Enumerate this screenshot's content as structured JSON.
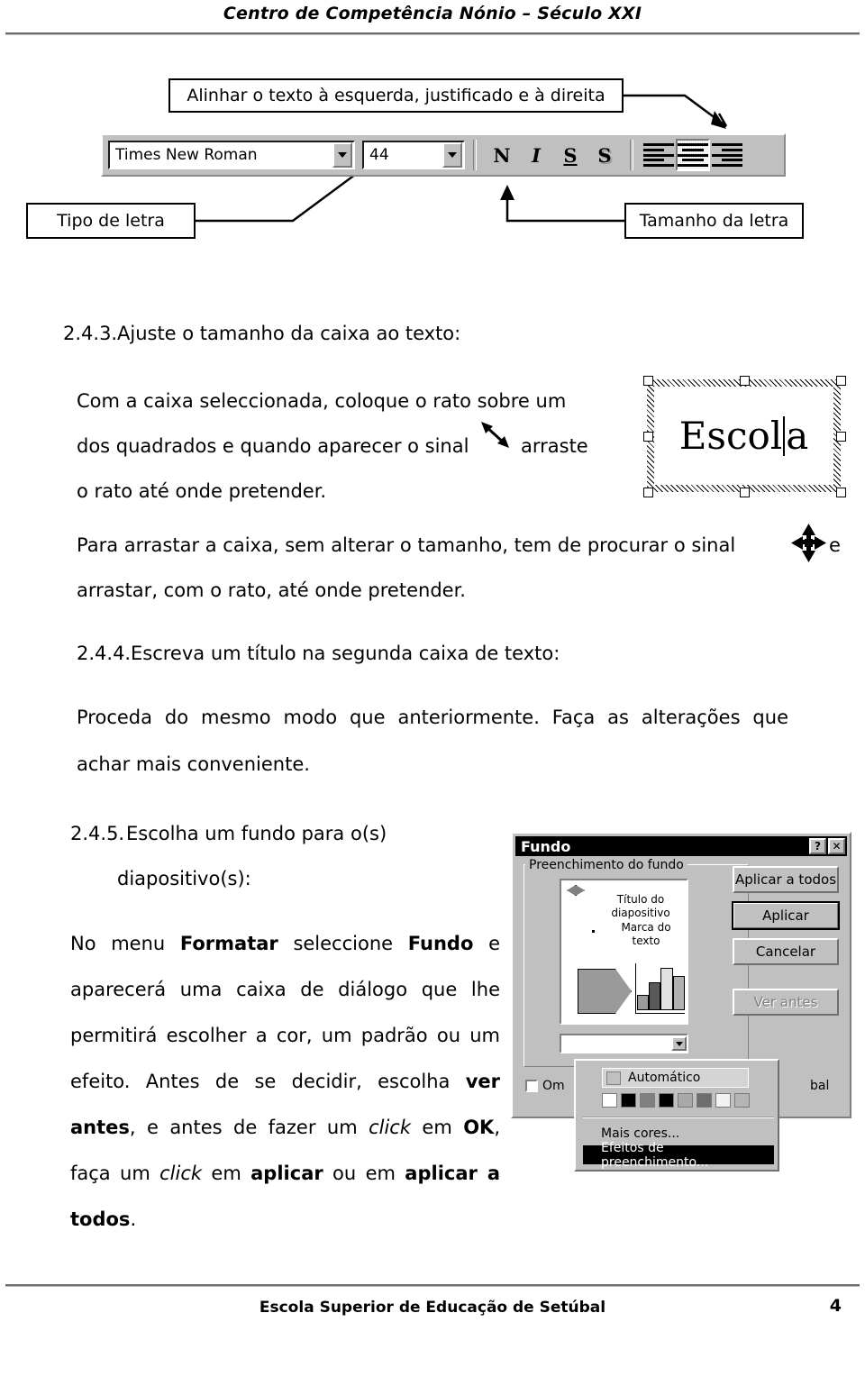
{
  "header": {
    "title": "Centro de Competência Nónio – Século XXI"
  },
  "callouts": {
    "align": "Alinhar o texto à esquerda, justificado e à direita",
    "font_type": "Tipo de letra",
    "font_size": "Tamanho da letra"
  },
  "toolbar": {
    "font_name": "Times New Roman",
    "font_size": "44",
    "bold_label": "N",
    "italic_label": "I",
    "underline_label": "S",
    "shadow_label": "S",
    "align_left_name": "align-left",
    "align_center_name": "align-center",
    "align_right_name": "align-right"
  },
  "sections": {
    "s243": {
      "number": "2.4.3.",
      "heading": "Ajuste o tamanho da caixa ao texto:",
      "para_1a": "Com a caixa seleccionada, coloque o rato sobre um",
      "para_1b": "dos quadrados e quando aparecer o sinal",
      "para_1c": "arraste",
      "para_1d": "o rato até onde pretender.",
      "para_2a": "Para arrastar a caixa, sem alterar o tamanho, tem de procurar o sinal",
      "para_2b": "e",
      "para_2c": "arrastar, com o rato, até onde pretender."
    },
    "s244": {
      "number": "2.4.4.",
      "heading": "Escreva um título na segunda caixa de texto:",
      "para": "Proceda do mesmo modo que anteriormente. Faça as alterações que achar mais conveniente."
    },
    "s245": {
      "number": "2.4.5.",
      "heading_a": "Escolha   um   fundo   para   o(s)",
      "heading_b": "diapositivo(s):",
      "p1": "No menu ",
      "p2": "Formatar",
      "p3": " seleccione ",
      "p4": "Fundo",
      "p5": " e aparecerá uma caixa de diálogo que lhe permitirá escolher a cor, um padrão ou um efeito. Antes de se decidir, escolha ",
      "p6": "ver antes",
      "p7": ", e antes de fazer um ",
      "p8": "click",
      "p9": " em ",
      "p10": "OK",
      "p11": ", faça um ",
      "p12": "click",
      "p13": " em ",
      "p14": "aplicar",
      "p15": " ou em ",
      "p16": "aplicar a todos",
      "p17": "."
    }
  },
  "textbox": {
    "text_before": "Escol",
    "text_after": "a"
  },
  "dialog": {
    "title": "Fundo",
    "help_btn": "?",
    "close_btn": "✕",
    "group_label": "Preenchimento do fundo",
    "preview": {
      "title_line1": "Título do",
      "title_line2": "diapositivo",
      "mark_line1": "Marca do",
      "mark_line2": "texto"
    },
    "buttons": {
      "apply_all": "Aplicar a todos",
      "apply": "Aplicar",
      "cancel": "Cancelar",
      "preview": "Ver antes"
    },
    "checkbox_label_left": "Om",
    "checkbox_label_right": "bal"
  },
  "color_dropdown": {
    "automatic": "Automático",
    "swatches": [
      "#ffffff",
      "#000000",
      "#808080",
      "#000000",
      "#a9a9a9",
      "#6e6e6e",
      "#f2f2f2",
      "#b5b5b5"
    ],
    "more_colors": "Mais cores...",
    "fill_effects": "Efeitos de preenchimento..."
  },
  "footer": {
    "text": "Escola Superior de Educação de Setúbal",
    "page": "4"
  }
}
